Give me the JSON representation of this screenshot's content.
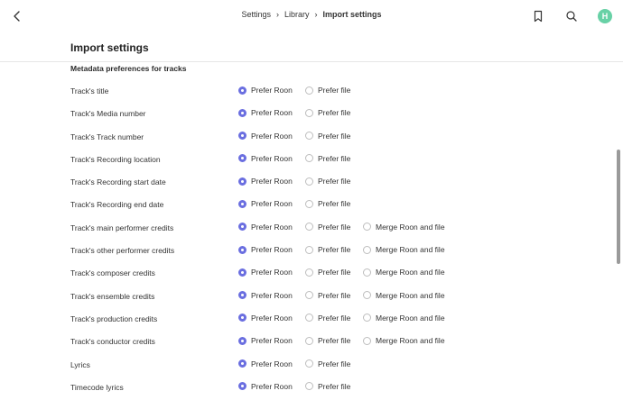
{
  "breadcrumbs": [
    {
      "label": "Settings"
    },
    {
      "label": "Library"
    },
    {
      "label": "Import settings"
    }
  ],
  "avatar_initial": "H",
  "page_title": "Import settings",
  "section_title": "Metadata preferences for tracks",
  "options": {
    "prefer_roon": "Prefer Roon",
    "prefer_file": "Prefer file",
    "merge": "Merge Roon and file"
  },
  "colors": {
    "accent": "#6a6ee0",
    "avatar": "#68d1a6"
  },
  "rows": [
    {
      "label": "Track's title",
      "selected": "prefer_roon",
      "has_merge": false
    },
    {
      "label": "Track's Media number",
      "selected": "prefer_roon",
      "has_merge": false
    },
    {
      "label": "Track's Track number",
      "selected": "prefer_roon",
      "has_merge": false
    },
    {
      "label": "Track's Recording location",
      "selected": "prefer_roon",
      "has_merge": false
    },
    {
      "label": "Track's Recording start date",
      "selected": "prefer_roon",
      "has_merge": false
    },
    {
      "label": "Track's Recording end date",
      "selected": "prefer_roon",
      "has_merge": false
    },
    {
      "label": "Track's main performer credits",
      "selected": "prefer_roon",
      "has_merge": true
    },
    {
      "label": "Track's other performer credits",
      "selected": "prefer_roon",
      "has_merge": true
    },
    {
      "label": "Track's composer credits",
      "selected": "prefer_roon",
      "has_merge": true
    },
    {
      "label": "Track's ensemble credits",
      "selected": "prefer_roon",
      "has_merge": true
    },
    {
      "label": "Track's production credits",
      "selected": "prefer_roon",
      "has_merge": true
    },
    {
      "label": "Track's conductor credits",
      "selected": "prefer_roon",
      "has_merge": true
    },
    {
      "label": "Lyrics",
      "selected": "prefer_roon",
      "has_merge": false
    },
    {
      "label": "Timecode lyrics",
      "selected": "prefer_roon",
      "has_merge": false
    }
  ]
}
